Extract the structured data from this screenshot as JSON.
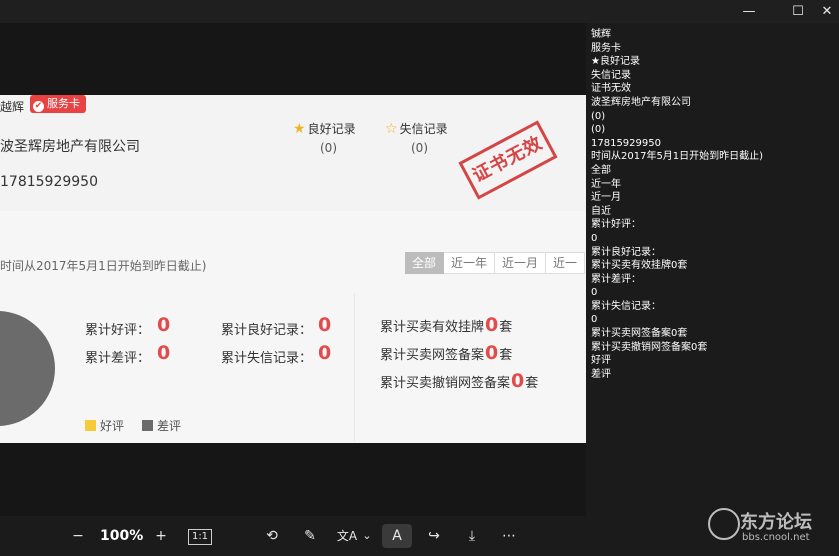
{
  "window": {
    "minimize": "—",
    "maximize": "☐",
    "close": "✕"
  },
  "card": {
    "name": "越辉",
    "badge": "服务卡",
    "company": "波圣辉房地产有限公司",
    "phone": "17815929950",
    "good_record_label": "良好记录",
    "good_record_count": "(0)",
    "bad_record_label": "失信记录",
    "bad_record_count": "(0)",
    "stamp": "证书无效",
    "period": "时间从2017年5月1日开始到昨日截止)",
    "tabs": [
      "全部",
      "近一年",
      "近一月",
      "近一"
    ],
    "stats": {
      "good_review_label": "累计好评：",
      "good_review_value": "0",
      "bad_review_label": "累计差评：",
      "bad_review_value": "0",
      "good_record_label": "累计良好记录：",
      "good_record_value": "0",
      "bad_record_label": "累计失信记录：",
      "bad_record_value": "0",
      "listing_label": "累计买卖有效挂牌",
      "listing_value": "0",
      "listing_unit": "套",
      "signed_label": "累计买卖网签备案",
      "signed_value": "0",
      "signed_unit": "套",
      "cancel_label": "累计买卖撤销网签备案",
      "cancel_value": "0",
      "cancel_unit": "套"
    },
    "legend": {
      "good": "好评",
      "bad": "差评"
    },
    "colors": {
      "good": "#f5cb3c",
      "bad": "#6b6b6b",
      "accent": "#e84343"
    }
  },
  "ocr_lines": [
    "铖辉",
    "服务卡",
    "★良好记录",
    "失信记录",
    "证书无效",
    "波圣辉房地产有限公司",
    "(0)",
    "(0)",
    "17815929950",
    "时间从2017年5月1日开始到昨日截止)",
    "全部",
    "近一年",
    "近一月",
    "自近",
    "累计好评：",
    "0",
    "累计良好记录：",
    "累计买卖有效挂牌0套",
    "累计差评：",
    "0",
    "累计失信记录：",
    "0",
    "累计买卖网签备案0套",
    "累计买卖撤销网签备案0套",
    "好评",
    "差评"
  ],
  "toolbar": {
    "zoom_out": "−",
    "zoom_level": "100%",
    "zoom_in": "+",
    "actual_size": "1:1",
    "rotate": "⟲",
    "edit": "✎",
    "translate": "文A",
    "dropdown": "⌄",
    "ocr": "A",
    "share": "↪",
    "download": "⤓",
    "more": "⋯"
  },
  "watermark": {
    "title": "东方论坛",
    "url": "bbs.cnool.net"
  }
}
